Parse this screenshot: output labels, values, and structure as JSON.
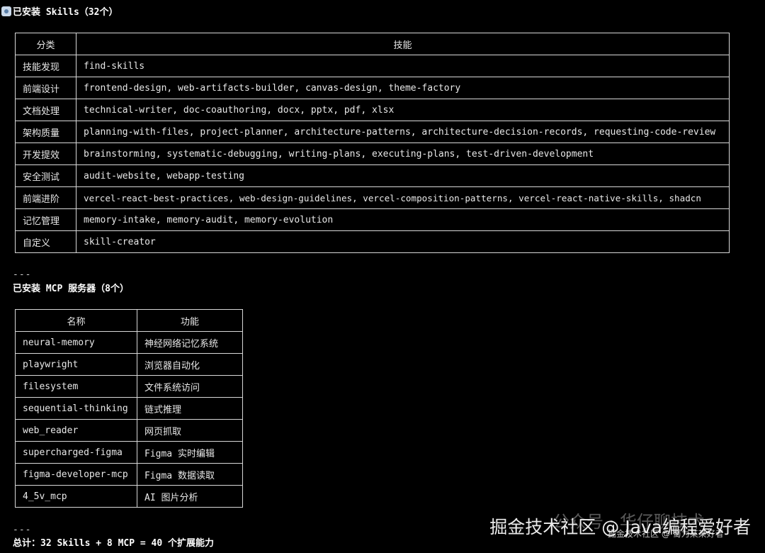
{
  "skills": {
    "heading": "已安装 Skills（32个）",
    "headers": [
      "分类",
      "技能"
    ],
    "rows": [
      [
        "技能发现",
        "find-skills"
      ],
      [
        "前端设计",
        "frontend-design, web-artifacts-builder, canvas-design, theme-factory"
      ],
      [
        "文档处理",
        "technical-writer, doc-coauthoring, docx, pptx, pdf, xlsx"
      ],
      [
        "架构质量",
        "planning-with-files, project-planner, architecture-patterns, architecture-decision-records, requesting-code-review"
      ],
      [
        "开发提效",
        "brainstorming, systematic-debugging, writing-plans, executing-plans, test-driven-development"
      ],
      [
        "安全测试",
        "audit-website, webapp-testing"
      ],
      [
        "前端进阶",
        "vercel-react-best-practices, web-design-guidelines, vercel-composition-patterns, vercel-react-native-skills, shadcn"
      ],
      [
        "记忆管理",
        "memory-intake, memory-audit, memory-evolution"
      ],
      [
        "自定义",
        "skill-creator"
      ]
    ]
  },
  "separator1": "---",
  "mcp": {
    "heading": "已安装 MCP 服务器（8个）",
    "headers": [
      "名称",
      "功能"
    ],
    "rows": [
      [
        "neural-memory",
        "神经网络记忆系统"
      ],
      [
        "playwright",
        "浏览器自动化"
      ],
      [
        "filesystem",
        "文件系统访问"
      ],
      [
        "sequential-thinking",
        "链式推理"
      ],
      [
        "web_reader",
        "网页抓取"
      ],
      [
        "supercharged-figma",
        "Figma 实时编辑"
      ],
      [
        "figma-developer-mcp",
        "Figma 数据读取"
      ],
      [
        "4_5v_mcp",
        "AI 图片分析"
      ]
    ]
  },
  "separator2": "---",
  "total": "总计：32 Skills + 8 MCP = 40 个扩展能力",
  "watermark": {
    "main": "掘金技术社区 @ Java编程爱好者",
    "ghost": "公众号 · 华仔聊技术",
    "small": "掘金技术社区 @ 蜀为某某好者"
  },
  "colors": {
    "background": "#000000",
    "text": "#e6e6e6",
    "border": "#d8d8d8"
  }
}
